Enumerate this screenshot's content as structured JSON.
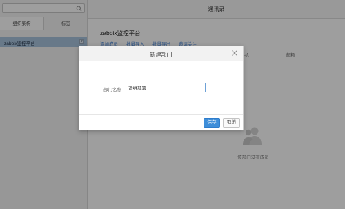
{
  "sidebar": {
    "search": {
      "placeholder": "",
      "value": "",
      "icon": "search-icon"
    },
    "tabs": [
      {
        "label": "组织架构",
        "active": true
      },
      {
        "label": "标签",
        "active": false
      }
    ],
    "tree": [
      {
        "label": "zabbix监控平台",
        "selected": true,
        "menu_icon": "chevron-down-icon"
      }
    ]
  },
  "main": {
    "title": "通讯录",
    "org_name": "zabbix监控平台",
    "actions": [
      "添加成员",
      "批量导入",
      "批量导出",
      "邀请关注"
    ],
    "columns": [
      "手机",
      "邮箱"
    ],
    "empty_text": "该部门没有成员",
    "empty_icon": "users-icon"
  },
  "dialog": {
    "title": "新建部门",
    "field_label": "部门名称",
    "field_value": "运维部署",
    "save_label": "保存",
    "cancel_label": "取消",
    "close_icon": "close-icon"
  },
  "colors": {
    "accent": "#3e8ed9",
    "link": "#3b7bd0",
    "selected_bg": "#a9c3dd",
    "overlay": "rgba(0,0,0,0.38)"
  }
}
